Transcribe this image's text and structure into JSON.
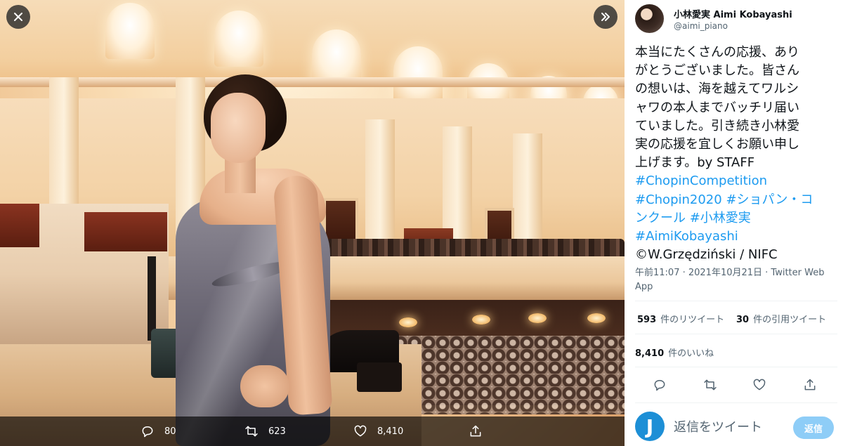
{
  "viewer": {
    "photo_alt": "小林愛実 on stage",
    "close_icon": "close-icon",
    "next_icon": "double-chevron-right-icon",
    "actions": {
      "reply_count": "80",
      "retweet_count": "623",
      "like_count": "8,410"
    }
  },
  "tweet": {
    "display_name": "小林愛実 Aimi Kobayashi",
    "handle": "@aimi_piano",
    "text_lines": [
      "本当にたくさんの応援、あり",
      "がとうございました。皆さん",
      "の想いは、海を越えてワルシ",
      "ャワの本人までバッチリ届い",
      "ていました。引き続き小林愛",
      "実の応援を宜しくお願い申し",
      "上げます。by STAFF"
    ],
    "hashtag_line1": "#ChopinCompetition",
    "hashtag_line2a": "#Chopin2020",
    "hashtag_line2b": " #ショパン・コ",
    "hashtag_line3a": "ンクール",
    "hashtag_line3b": " #小林愛実",
    "hashtag_line4": "#AimiKobayashi",
    "credit": "©W.Grzędziński / NIFC",
    "timestamp": "午前11:07 · 2021年10月21日 · Twitter Web App",
    "retweets_count": "593",
    "retweets_label": "件のリツイート",
    "quotes_count": "30",
    "quotes_label": "件の引用ツイート",
    "likes_count": "8,410",
    "likes_label": "件のいいね"
  },
  "reply": {
    "avatar_letter": "J",
    "placeholder": "返信をツイート",
    "button_label": "返信"
  },
  "colors": {
    "accent": "#1d9bf0",
    "reply_button": "#8ecdf7",
    "text": "#0f1419",
    "secondary": "#536471"
  }
}
